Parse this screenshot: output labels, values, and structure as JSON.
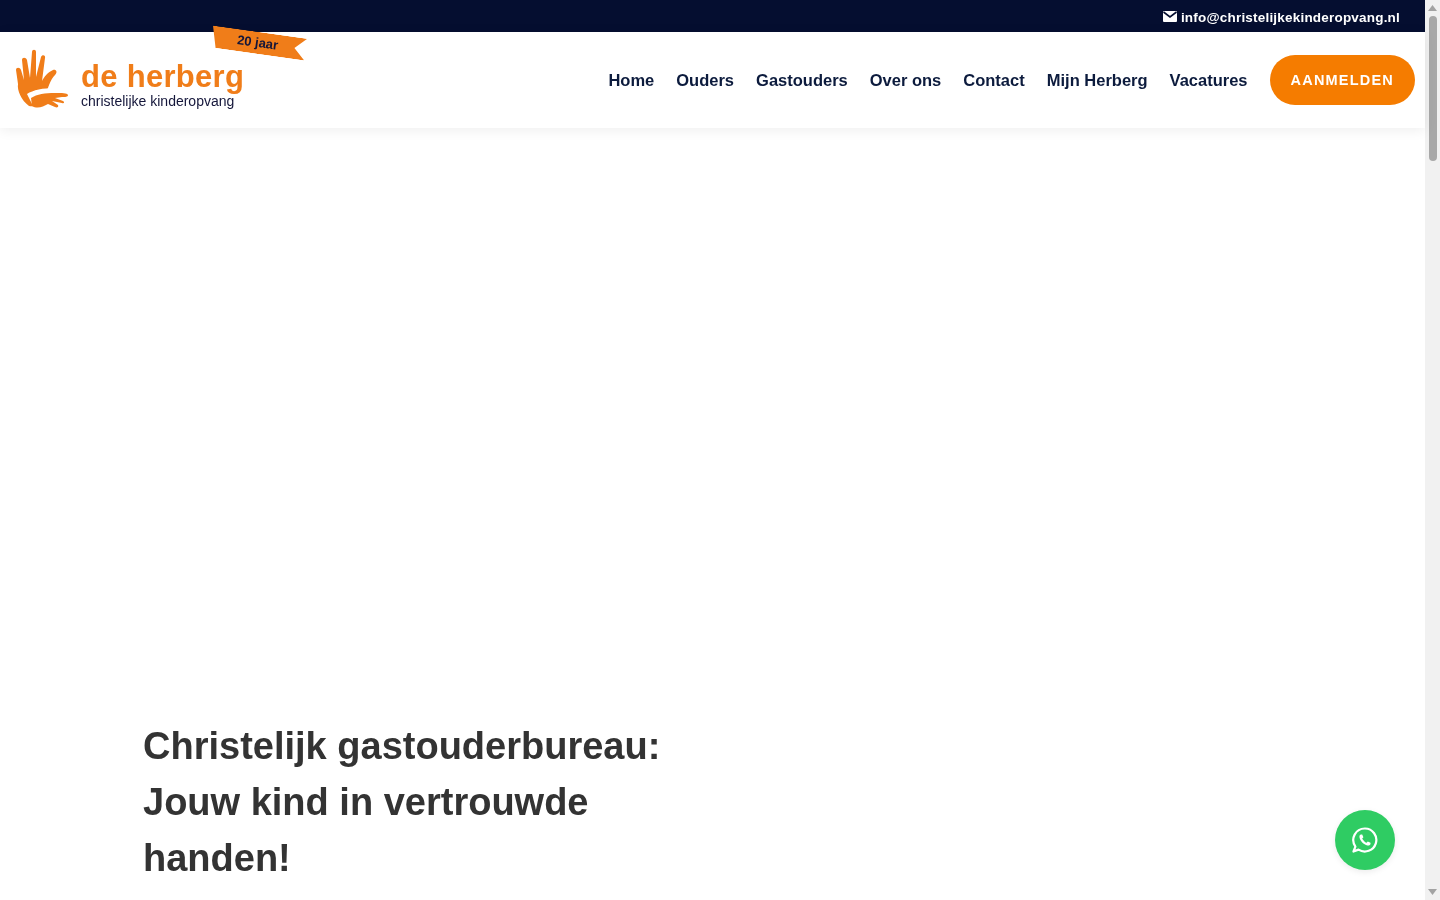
{
  "top_bar": {
    "email": "info@christelijkekinderopvang.nl"
  },
  "header": {
    "logo": {
      "name": "de herberg",
      "tagline": "christelijke kinderopvang",
      "ribbon": "20 jaar"
    },
    "nav": [
      {
        "label": "Home"
      },
      {
        "label": "Ouders"
      },
      {
        "label": "Gastouders"
      },
      {
        "label": "Over ons"
      },
      {
        "label": "Contact"
      },
      {
        "label": "Mijn Herberg"
      },
      {
        "label": "Vacatures"
      }
    ],
    "cta": "AANMELDEN"
  },
  "hero": {
    "heading": "Christelijk gastouderbureau: Jouw kind in vertrouwde handen!"
  }
}
